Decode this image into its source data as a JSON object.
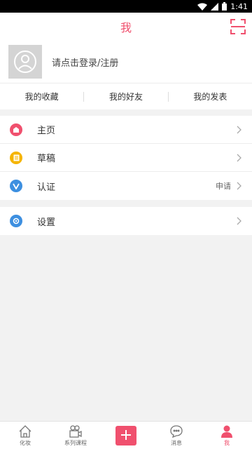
{
  "status_bar": {
    "time": "1:41"
  },
  "header": {
    "title": "我"
  },
  "profile": {
    "login_text": "请点击登录/注册"
  },
  "tabs": [
    {
      "label": "我的收藏"
    },
    {
      "label": "我的好友"
    },
    {
      "label": "我的发表"
    }
  ],
  "menu": {
    "group1": [
      {
        "label": "主页",
        "icon": "home-icon",
        "color": "#f0506e"
      },
      {
        "label": "草稿",
        "icon": "draft-icon",
        "color": "#f5b400"
      },
      {
        "label": "认证",
        "icon": "verify-icon",
        "color": "#3d8fe0",
        "extra": "申请"
      }
    ],
    "group2": [
      {
        "label": "设置",
        "icon": "settings-icon",
        "color": "#3d8fe0"
      }
    ]
  },
  "bottom_nav": [
    {
      "label": "化妆",
      "icon": "house-icon"
    },
    {
      "label": "系列课程",
      "icon": "video-icon"
    },
    {
      "label": "",
      "icon": "plus-icon"
    },
    {
      "label": "消息",
      "icon": "chat-icon"
    },
    {
      "label": "我",
      "icon": "user-icon",
      "active": true
    }
  ],
  "colors": {
    "accent": "#f0506e",
    "background": "#f2f2f2"
  }
}
